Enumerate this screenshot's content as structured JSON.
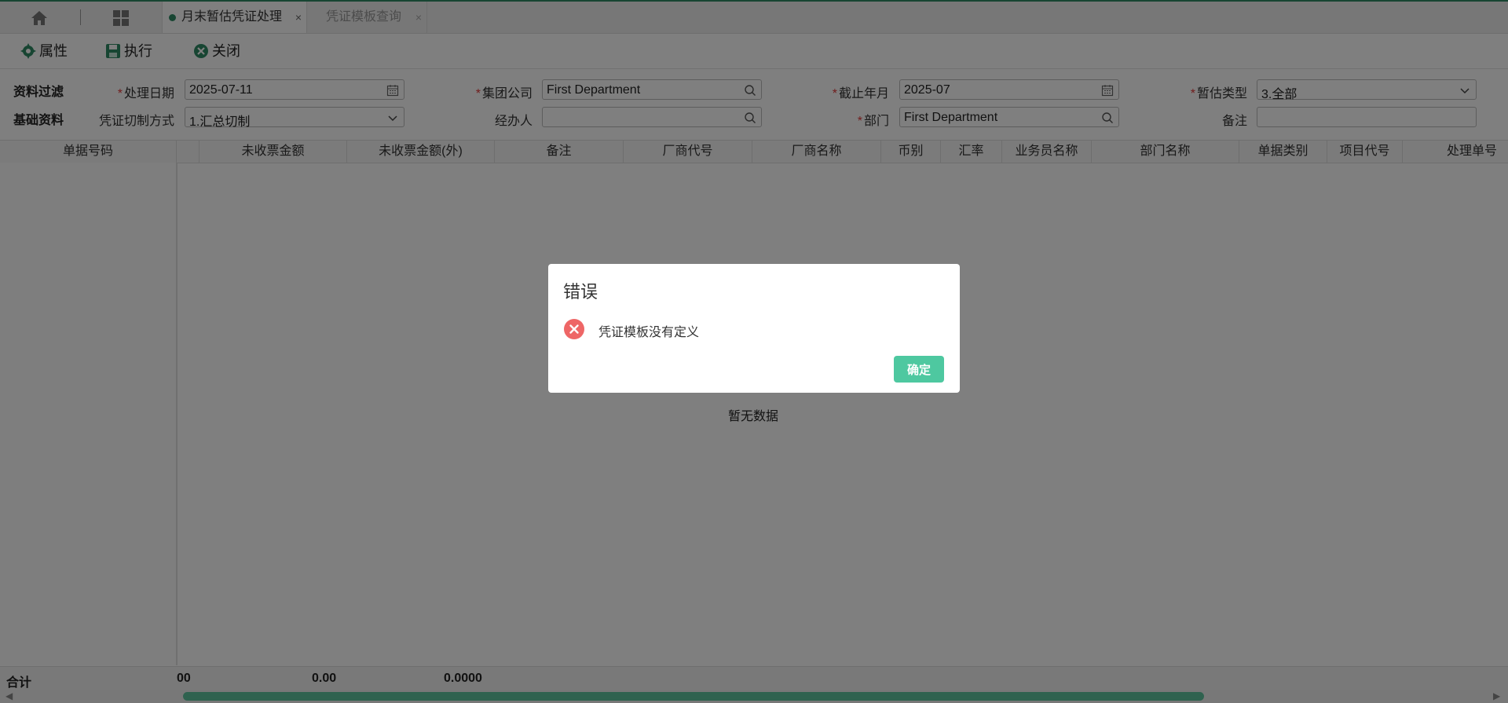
{
  "tabs": {
    "active_label": "月末暂估凭证处理",
    "inactive_label": "凭证模板查询",
    "close_glyph": "×"
  },
  "toolbar": {
    "properties_label": "属性",
    "execute_label": "执行",
    "close_label": "关闭"
  },
  "filters": {
    "section_filter": "资料过滤",
    "section_basic": "基础资料",
    "process_date_label": "处理日期",
    "process_date_value": "2025-07-11",
    "group_company_label": "集团公司",
    "group_company_value": "First Department",
    "cutoff_month_label": "截止年月",
    "cutoff_month_value": "2025-07",
    "estimate_type_label": "暂估类型",
    "estimate_type_value": "3.全部",
    "voucher_split_label": "凭证切制方式",
    "voucher_split_value": "1.汇总切制",
    "handler_label": "经办人",
    "handler_value": "",
    "department_label": "部门",
    "department_value": "First Department",
    "remark_label": "备注",
    "remark_value": "",
    "required_mark": "*"
  },
  "grid": {
    "columns": [
      "单据号码",
      "",
      "未收票金额",
      "未收票金额(外)",
      "备注",
      "厂商代号",
      "厂商名称",
      "币别",
      "汇率",
      "业务员名称",
      "部门名称",
      "单据类别",
      "项目代号",
      "处理单号"
    ],
    "empty_text": "暂无数据",
    "total_label": "合计",
    "totals": [
      "00",
      "0.00",
      "0.0000"
    ]
  },
  "dialog": {
    "title": "错误",
    "message": "凭证模板没有定义",
    "ok_label": "确定"
  },
  "colors": {
    "accent": "#2e8b65",
    "ok_button": "#4ec8a0",
    "error_icon": "#ee6666",
    "required": "#e23a3a"
  }
}
